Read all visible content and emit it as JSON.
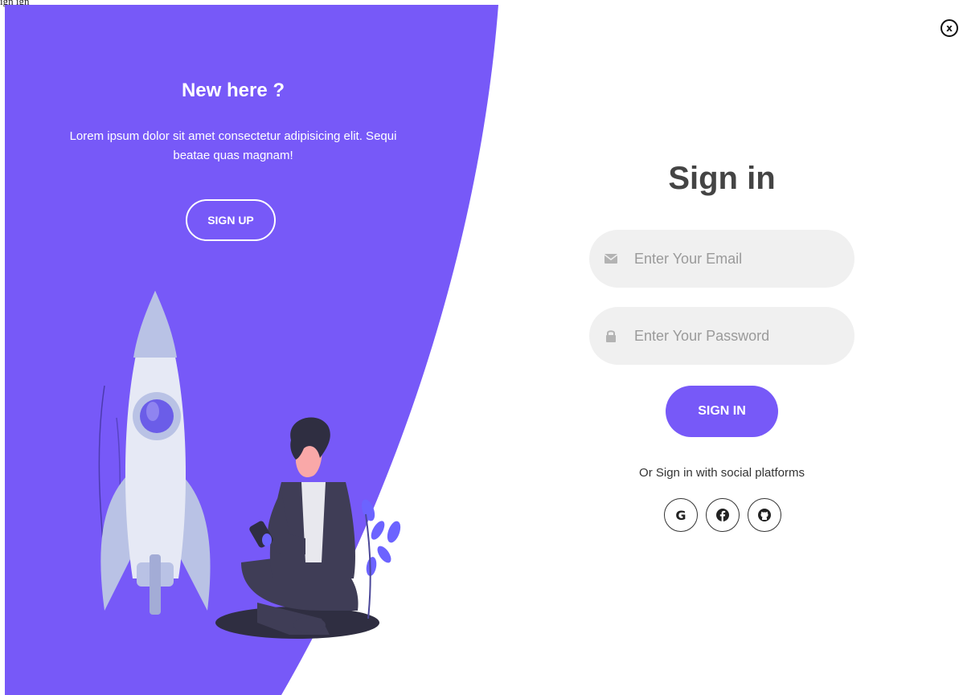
{
  "top_fragment": "ign ign",
  "left_panel": {
    "title": "New here ?",
    "text": "Lorem ipsum dolor sit amet consectetur adipisicing elit. Sequi beatae quas magnam!",
    "signup_label": "SIGN UP"
  },
  "form": {
    "title": "Sign in",
    "email_placeholder": "Enter Your Email",
    "password_placeholder": "Enter Your Password",
    "signin_label": "SIGN IN",
    "social_text": "Or Sign in with social platforms",
    "social": [
      {
        "name": "google-icon",
        "glyph": "G"
      },
      {
        "name": "facebook-icon",
        "glyph": "f"
      },
      {
        "name": "github-icon",
        "glyph": "github"
      }
    ]
  },
  "close_glyph": "x",
  "colors": {
    "accent": "#7759f8",
    "input_bg": "#f0f0f0",
    "title": "#444444"
  }
}
